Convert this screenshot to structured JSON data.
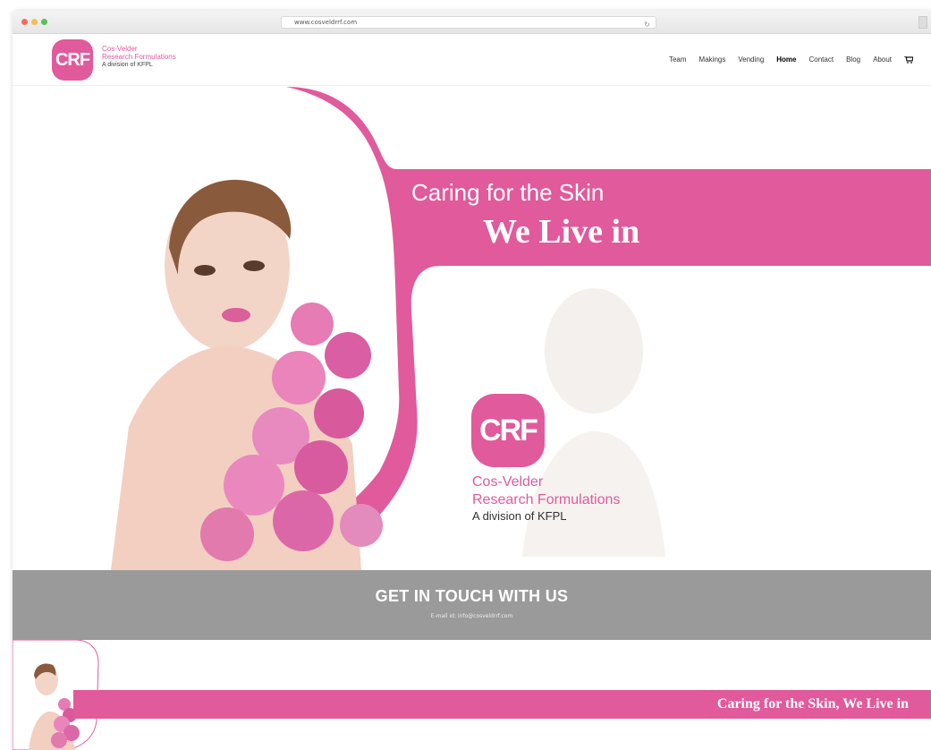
{
  "browser": {
    "url": "www.cosveldrrf.com"
  },
  "header": {
    "logo_badge": "CRF",
    "logo_line1": "Cos-Velder",
    "logo_line2": "Research Formulations",
    "logo_line3": "A division of KFPL",
    "nav": [
      {
        "label": "Team"
      },
      {
        "label": "Makings"
      },
      {
        "label": "Vending"
      },
      {
        "label": "Home"
      },
      {
        "label": "Contact"
      },
      {
        "label": "Blog"
      },
      {
        "label": "About"
      }
    ],
    "cart_icon": "cart-icon"
  },
  "hero": {
    "title_line1": "Caring for the Skin",
    "title_line2": "We Live in",
    "brand_badge": "CRF",
    "brand_line1": "Cos-Velder",
    "brand_line2": "Research Formulations",
    "brand_line3": "A division of KFPL"
  },
  "contact": {
    "title": "GET IN TOUCH WITH US",
    "email_line": "E-mail id: info@cosveldrrf.com"
  },
  "footer": {
    "tagline": "Caring for the Skin, We Live in"
  },
  "colors": {
    "brand_pink": "#e05a9c",
    "contact_gray": "#9a9a9a"
  }
}
